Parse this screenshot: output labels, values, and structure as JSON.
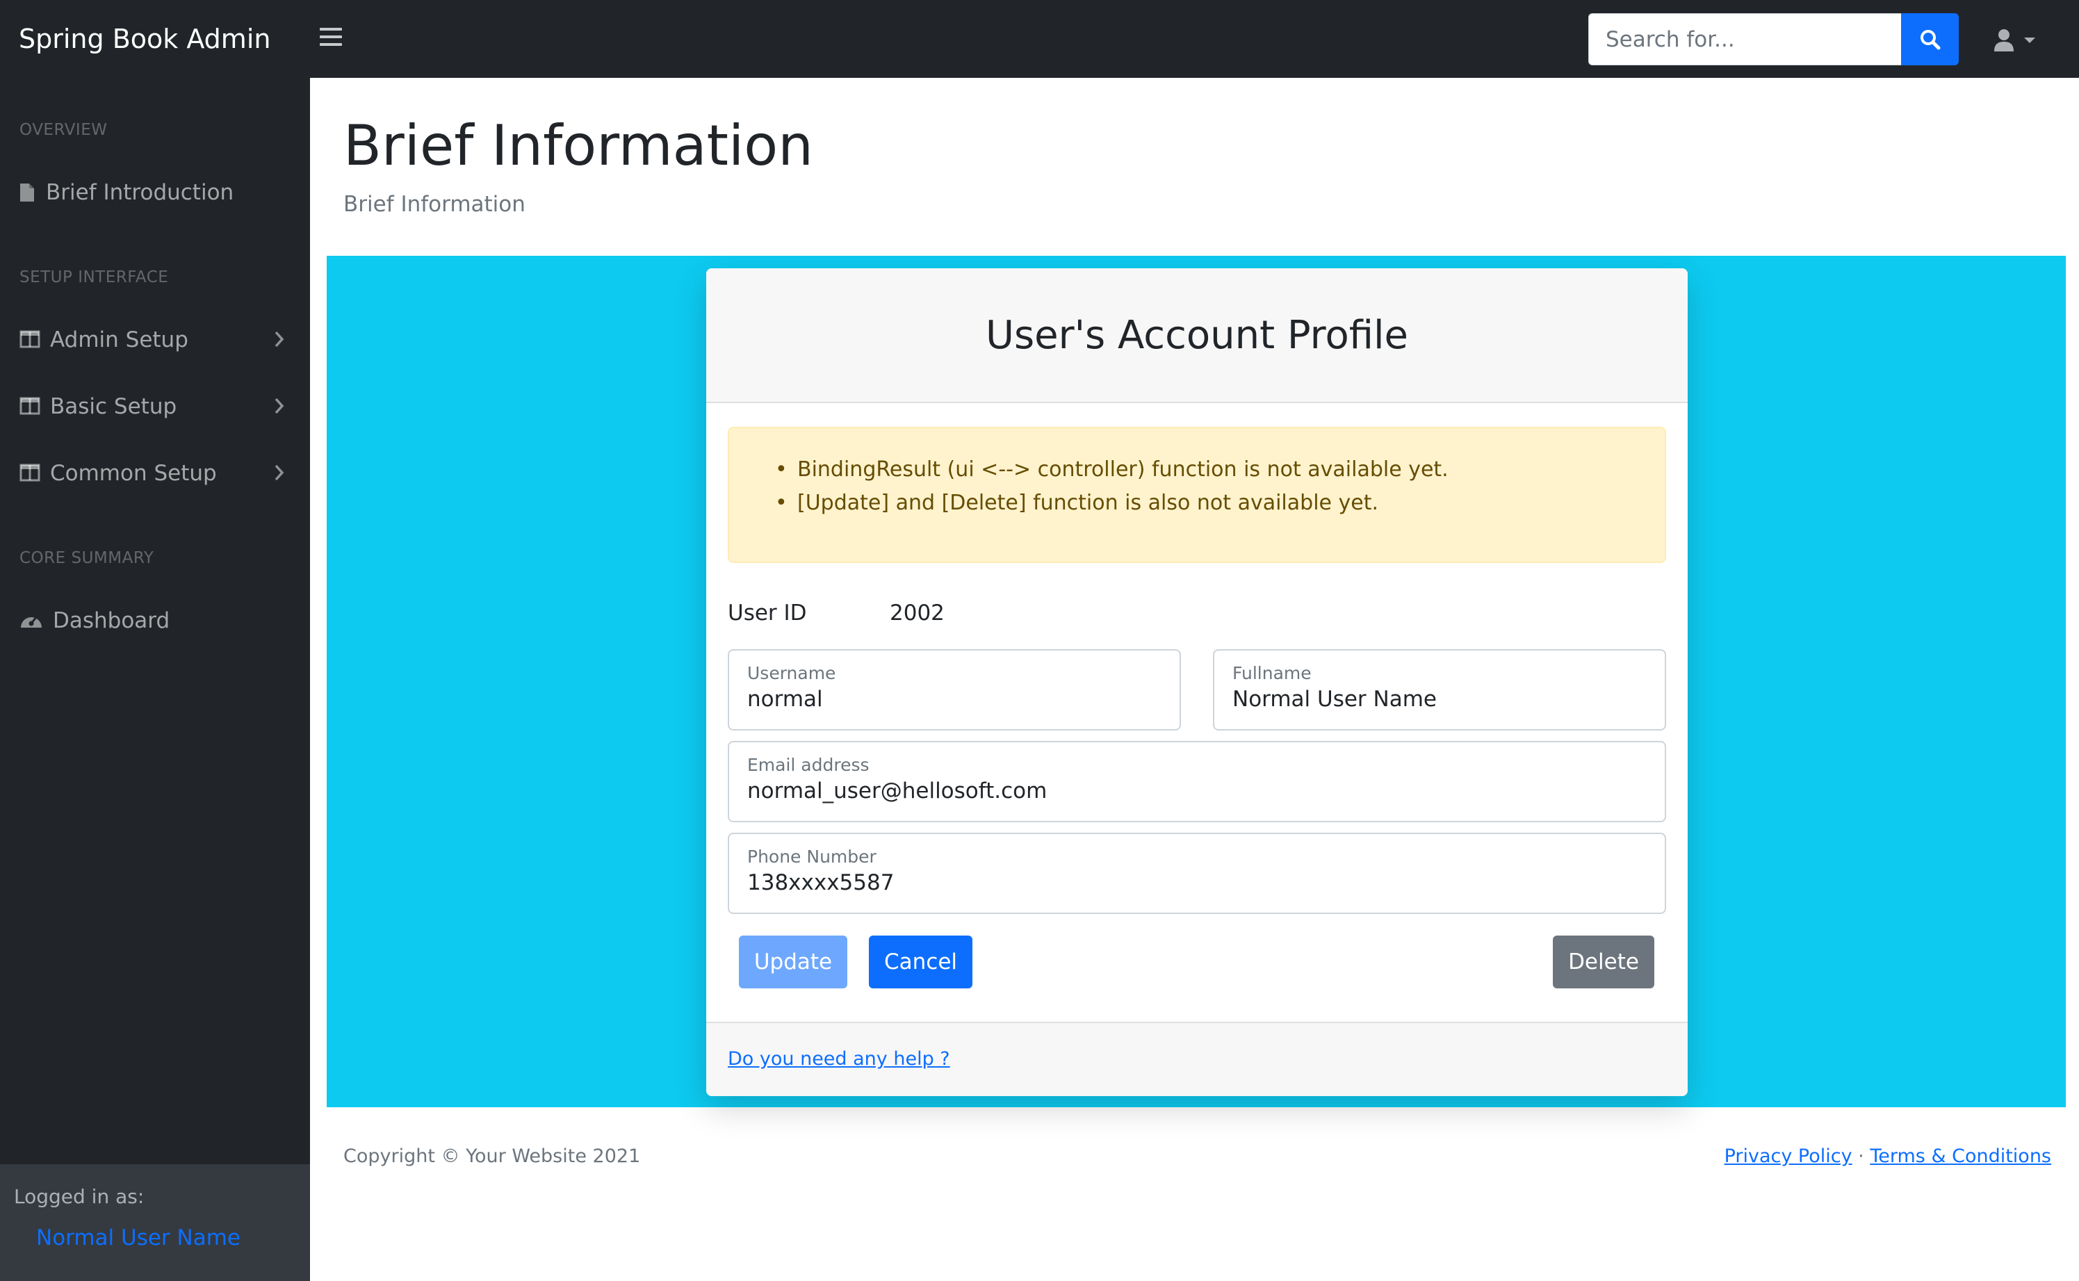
{
  "app": {
    "brand": "Spring Book Admin"
  },
  "search": {
    "placeholder": "Search for..."
  },
  "sidebar": {
    "headings": [
      "OVERVIEW",
      "SETUP INTERFACE",
      "CORE SUMMARY"
    ],
    "items": [
      {
        "label": "Brief Introduction",
        "icon": "file-icon"
      },
      {
        "label": "Admin Setup",
        "icon": "columns-icon",
        "has_submenu": true
      },
      {
        "label": "Basic Setup",
        "icon": "columns-icon",
        "has_submenu": true
      },
      {
        "label": "Common Setup",
        "icon": "columns-icon",
        "has_submenu": true
      },
      {
        "label": "Dashboard",
        "icon": "dashboard-icon"
      }
    ],
    "footer": {
      "logged_in_label": "Logged in as:",
      "user_name": "Normal User Name"
    }
  },
  "main": {
    "title": "Brief Information",
    "breadcrumb": "Brief Information"
  },
  "card": {
    "title": "User's Account Profile",
    "alerts": [
      "BindingResult (ui <--> controller) function is not available yet.",
      "[Update] and [Delete] function is also not available yet."
    ],
    "user_id_label": "User ID",
    "user_id_value": "2002",
    "fields": {
      "username": {
        "label": "Username",
        "value": "normal"
      },
      "fullname": {
        "label": "Fullname",
        "value": "Normal User Name"
      },
      "email": {
        "label": "Email address",
        "value": "normal_user@hellosoft.com"
      },
      "phone": {
        "label": "Phone Number",
        "value": "138xxxx5587"
      }
    },
    "buttons": {
      "update": "Update",
      "cancel": "Cancel",
      "delete": "Delete"
    },
    "help_link": "Do you need any help ?"
  },
  "footer": {
    "copyright": "Copyright © Your Website 2021",
    "privacy": "Privacy Policy",
    "separator": "·",
    "terms": "Terms & Conditions"
  },
  "colors": {
    "navbar": "#212529",
    "accent": "#0d6efd",
    "info_panel": "#0dcaf0",
    "alert_bg": "#fff3cd",
    "alert_text": "#664d03"
  }
}
